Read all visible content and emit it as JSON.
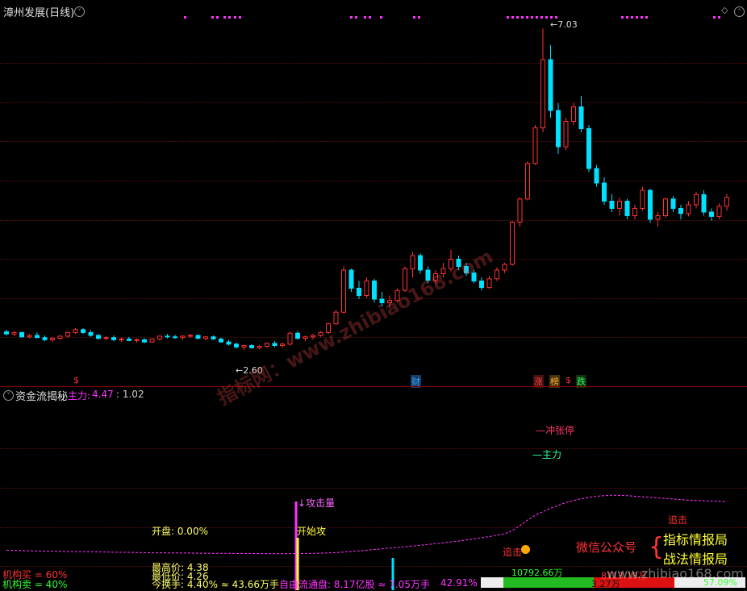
{
  "upper_panel": {
    "title": "漳州发展(日线)",
    "high_label": "7.03",
    "low_label": "2.60",
    "event_tags": [
      {
        "text": "$",
        "color": "#ff3333"
      },
      {
        "text": "财",
        "color": "#33aaff"
      },
      {
        "text": "涨",
        "color": "#ff4444"
      },
      {
        "text": "榜",
        "color": "#ffaa33"
      },
      {
        "text": "$",
        "color": "#ff3333"
      },
      {
        "text": "跌",
        "color": "#33ff66"
      }
    ]
  },
  "lower_panel": {
    "title": "资金流揭秘",
    "main_label": "主力:",
    "main_value": "4.47",
    "ratio": ": 1.02",
    "annotations": {
      "chong_zhang_ting": "冲张停",
      "zhu_li": "主力",
      "gong_ji_liang": "攻击量",
      "kai_shi_gong": "开始攻",
      "zhui_ji_1": "追击",
      "zhui_ji_2": "追击"
    },
    "stats": {
      "open": "开盘: 0.00%",
      "high": "最高价: 4.38",
      "low": "最低价: 4.26",
      "turnover": "今换手: 4.40% ≈ 43.66万手",
      "float_share": "自由流通盘: 8.17亿股 ≈ 7.05万手",
      "pct": "42.91%",
      "inst_buy": "机构买 = 60%",
      "inst_sell": "机构卖 = 40%",
      "vol_a": "10792.66万",
      "vol_b": "8113.18万",
      "vol_c": "3.27万",
      "vol_d": "57.09%"
    },
    "promo": {
      "wechat": "微信公众号",
      "line1": "指标情报局",
      "line2": "战法情报局"
    }
  },
  "watermark": {
    "main": "指标网：www.zhibiao168.com",
    "bottom": "www.zhibiao168.com"
  },
  "colors": {
    "up": "#ff3232",
    "down": "#00e0ff",
    "grid": "#5a1010",
    "divider": "#8a0000",
    "magenta": "#ff33ff",
    "yellow": "#ffff33"
  },
  "chart_data": {
    "type": "candlestick",
    "title": "漳州发展(日线)",
    "labeled_extremes": {
      "high": 7.03,
      "low": 2.6
    },
    "ohlc": [
      [
        2.85,
        2.88,
        2.8,
        2.82
      ],
      [
        2.82,
        2.86,
        2.79,
        2.84
      ],
      [
        2.84,
        2.85,
        2.77,
        2.78
      ],
      [
        2.78,
        2.82,
        2.76,
        2.8
      ],
      [
        2.8,
        2.84,
        2.76,
        2.77
      ],
      [
        2.77,
        2.8,
        2.72,
        2.74
      ],
      [
        2.74,
        2.78,
        2.71,
        2.76
      ],
      [
        2.76,
        2.8,
        2.74,
        2.79
      ],
      [
        2.79,
        2.85,
        2.77,
        2.84
      ],
      [
        2.84,
        2.9,
        2.82,
        2.88
      ],
      [
        2.88,
        2.9,
        2.82,
        2.84
      ],
      [
        2.84,
        2.87,
        2.78,
        2.8
      ],
      [
        2.8,
        2.82,
        2.74,
        2.76
      ],
      [
        2.76,
        2.79,
        2.73,
        2.77
      ],
      [
        2.77,
        2.8,
        2.72,
        2.74
      ],
      [
        2.74,
        2.77,
        2.71,
        2.75
      ],
      [
        2.75,
        2.78,
        2.72,
        2.73
      ],
      [
        2.73,
        2.76,
        2.7,
        2.74
      ],
      [
        2.74,
        2.76,
        2.69,
        2.71
      ],
      [
        2.71,
        2.76,
        2.7,
        2.75
      ],
      [
        2.75,
        2.8,
        2.73,
        2.79
      ],
      [
        2.79,
        2.82,
        2.76,
        2.78
      ],
      [
        2.78,
        2.81,
        2.75,
        2.77
      ],
      [
        2.77,
        2.8,
        2.74,
        2.79
      ],
      [
        2.79,
        2.82,
        2.77,
        2.8
      ],
      [
        2.8,
        2.81,
        2.75,
        2.76
      ],
      [
        2.76,
        2.79,
        2.73,
        2.78
      ],
      [
        2.78,
        2.8,
        2.74,
        2.75
      ],
      [
        2.75,
        2.77,
        2.7,
        2.71
      ],
      [
        2.71,
        2.74,
        2.66,
        2.68
      ],
      [
        2.68,
        2.7,
        2.62,
        2.64
      ],
      [
        2.64,
        2.67,
        2.6,
        2.66
      ],
      [
        2.66,
        2.68,
        2.62,
        2.63
      ],
      [
        2.63,
        2.67,
        2.61,
        2.65
      ],
      [
        2.65,
        2.7,
        2.63,
        2.69
      ],
      [
        2.69,
        2.72,
        2.64,
        2.66
      ],
      [
        2.66,
        2.7,
        2.63,
        2.68
      ],
      [
        2.68,
        2.85,
        2.66,
        2.83
      ],
      [
        2.83,
        2.86,
        2.74,
        2.76
      ],
      [
        2.76,
        2.8,
        2.72,
        2.78
      ],
      [
        2.78,
        2.82,
        2.74,
        2.8
      ],
      [
        2.8,
        2.86,
        2.78,
        2.84
      ],
      [
        2.84,
        2.98,
        2.82,
        2.96
      ],
      [
        2.96,
        3.15,
        2.94,
        3.12
      ],
      [
        3.12,
        3.75,
        3.1,
        3.7
      ],
      [
        3.7,
        3.72,
        3.4,
        3.45
      ],
      [
        3.45,
        3.55,
        3.3,
        3.35
      ],
      [
        3.35,
        3.6,
        3.32,
        3.55
      ],
      [
        3.55,
        3.58,
        3.25,
        3.3
      ],
      [
        3.3,
        3.4,
        3.2,
        3.25
      ],
      [
        3.25,
        3.35,
        3.18,
        3.28
      ],
      [
        3.28,
        3.45,
        3.25,
        3.42
      ],
      [
        3.42,
        3.75,
        3.4,
        3.72
      ],
      [
        3.72,
        3.95,
        3.6,
        3.9
      ],
      [
        3.9,
        3.93,
        3.65,
        3.7
      ],
      [
        3.7,
        3.75,
        3.52,
        3.56
      ],
      [
        3.56,
        3.7,
        3.5,
        3.65
      ],
      [
        3.65,
        3.8,
        3.6,
        3.72
      ],
      [
        3.72,
        3.98,
        3.68,
        3.85
      ],
      [
        3.85,
        3.9,
        3.7,
        3.75
      ],
      [
        3.75,
        3.8,
        3.62,
        3.66
      ],
      [
        3.66,
        3.7,
        3.52,
        3.55
      ],
      [
        3.55,
        3.6,
        3.42,
        3.46
      ],
      [
        3.46,
        3.62,
        3.44,
        3.58
      ],
      [
        3.58,
        3.74,
        3.55,
        3.7
      ],
      [
        3.7,
        3.8,
        3.66,
        3.78
      ],
      [
        3.78,
        4.38,
        3.76,
        4.36
      ],
      [
        4.36,
        4.7,
        4.3,
        4.68
      ],
      [
        4.68,
        5.2,
        4.66,
        5.17
      ],
      [
        5.17,
        5.7,
        5.15,
        5.66
      ],
      [
        5.66,
        7.03,
        5.6,
        6.6
      ],
      [
        6.6,
        6.8,
        5.8,
        5.9
      ],
      [
        5.9,
        6.0,
        5.3,
        5.4
      ],
      [
        5.4,
        5.8,
        5.35,
        5.75
      ],
      [
        5.75,
        6.0,
        5.7,
        5.95
      ],
      [
        5.95,
        6.1,
        5.6,
        5.65
      ],
      [
        5.65,
        5.7,
        5.05,
        5.1
      ],
      [
        5.1,
        5.15,
        4.85,
        4.9
      ],
      [
        4.9,
        4.98,
        4.6,
        4.65
      ],
      [
        4.65,
        4.75,
        4.5,
        4.55
      ],
      [
        4.55,
        4.7,
        4.45,
        4.65
      ],
      [
        4.65,
        4.68,
        4.4,
        4.45
      ],
      [
        4.45,
        4.6,
        4.4,
        4.55
      ],
      [
        4.55,
        4.85,
        4.52,
        4.8
      ],
      [
        4.8,
        4.82,
        4.35,
        4.4
      ],
      [
        4.4,
        4.5,
        4.3,
        4.45
      ],
      [
        4.45,
        4.7,
        4.42,
        4.68
      ],
      [
        4.68,
        4.72,
        4.5,
        4.55
      ],
      [
        4.55,
        4.6,
        4.4,
        4.48
      ],
      [
        4.48,
        4.65,
        4.44,
        4.6
      ],
      [
        4.6,
        4.78,
        4.55,
        4.74
      ],
      [
        4.74,
        4.8,
        4.45,
        4.5
      ],
      [
        4.5,
        4.55,
        4.38,
        4.44
      ],
      [
        4.44,
        4.62,
        4.4,
        4.58
      ],
      [
        4.58,
        4.75,
        4.52,
        4.7
      ]
    ],
    "main_force_line": [
      0.55,
      0.54,
      0.52,
      0.5,
      0.5,
      0.49,
      0.48,
      0.47,
      0.46,
      0.45,
      0.45,
      0.44,
      0.43,
      0.42,
      0.41,
      0.4,
      0.4,
      0.39,
      0.38,
      0.37,
      0.37,
      0.36,
      0.36,
      0.35,
      0.35,
      0.34,
      0.34,
      0.33,
      0.33,
      0.33,
      0.32,
      0.32,
      0.32,
      0.31,
      0.31,
      0.3,
      0.3,
      0.3,
      0.31,
      0.32,
      0.33,
      0.34,
      0.36,
      0.38,
      0.42,
      0.46,
      0.5,
      0.55,
      0.6,
      0.65,
      0.7,
      0.75,
      0.8,
      0.85,
      0.9,
      0.96,
      1.02,
      1.08,
      1.14,
      1.2,
      1.28,
      1.36,
      1.44,
      1.52,
      1.62,
      1.72,
      1.95,
      2.3,
      2.7,
      3.05,
      3.3,
      3.55,
      3.75,
      3.95,
      4.1,
      4.22,
      4.32,
      4.4,
      4.44,
      4.47,
      4.46,
      4.44,
      4.4,
      4.36,
      4.32,
      4.28,
      4.24,
      4.2,
      4.16,
      4.12,
      4.1,
      4.08,
      4.06,
      4.04,
      4.02
    ],
    "ylim": [
      2.2,
      7.2
    ]
  }
}
